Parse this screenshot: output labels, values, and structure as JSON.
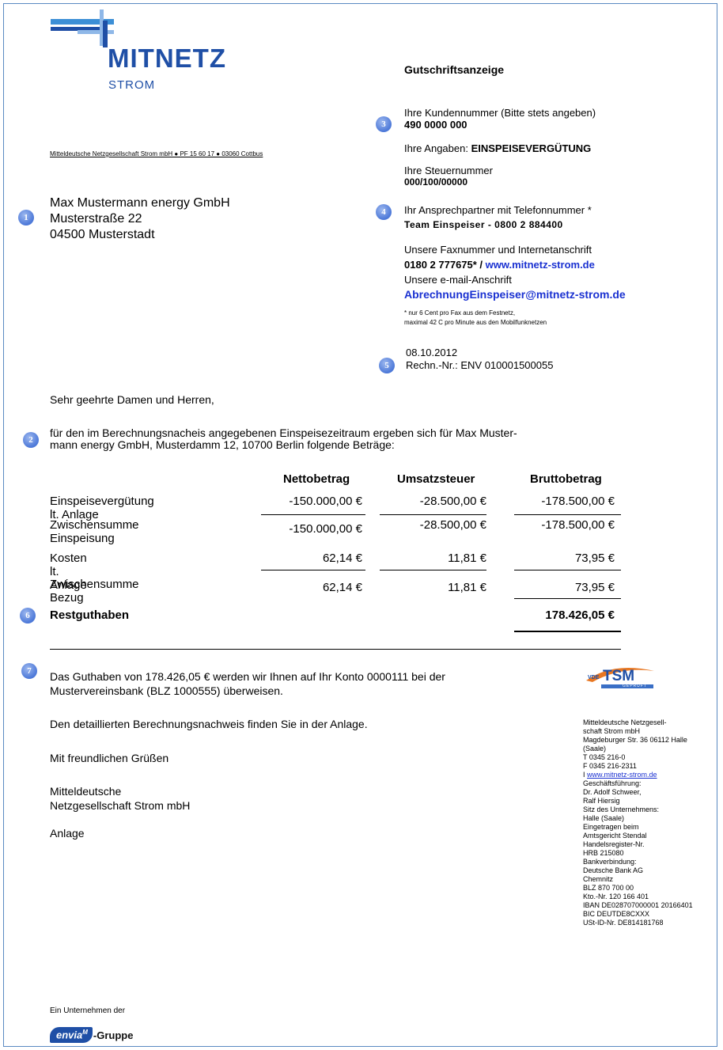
{
  "logo": {
    "name": "MITNETZ",
    "sub": "STROM"
  },
  "sender_line": "Mitteldeutsche Netzgesellschaft Strom mbH ● PF 15 60 17 ● 03060 Cottbus",
  "recipient": {
    "line1": "Max Mustermann energy GmbH",
    "line2": "Musterstraße 22",
    "line3": "04500 Musterstadt"
  },
  "info": {
    "title": "Gutschriftsanzeige",
    "customer_label": "Ihre Kundennummer (Bitte stets angeben)",
    "customer_number": "490 0000 000",
    "angaben_label": "Ihre Angaben: ",
    "angaben_value": "EINSPEISEVERGÜTUNG",
    "tax_label": "Ihre Steuernummer",
    "tax_number": "000/100/00000",
    "contact_label": "Ihr Ansprechpartner mit Telefonnummer *",
    "contact_value": "Team Einspeiser - 0800 2 884400",
    "fax_label": "Unsere Faxnummer und Internetanschrift",
    "fax_value": "0180 2 777675* / ",
    "web": "www.mitnetz-strom.de",
    "email_label": "Unsere e-mail-Anschrift",
    "email": "AbrechnungEinspeiser@mitnetz-strom.de",
    "note1": "*   nur 6 Cent pro Fax aus dem Festnetz,",
    "note2": "maximal 42 C pro Minute aus den Mobilfunknetzen",
    "date": "08.10.2012",
    "invoice": "Rechn.-Nr.: ENV 010001500055"
  },
  "badges": [
    "1",
    "2",
    "3",
    "4",
    "5",
    "6",
    "7"
  ],
  "greeting": "Sehr geehrte Damen und Herren,",
  "intro1": "für den im Berechnungsnacheis angegebenen Einspeisezeitraum ergeben sich für Max Muster-",
  "intro2": "mann energy GmbH, Musterdamm 12, 10700 Berlin folgende Beträge:",
  "table": {
    "headers": [
      "Nettobetrag",
      "Umsatzsteuer",
      "Bruttobetrag"
    ],
    "rows": [
      {
        "label": "Einspeisevergütung lt. Anlage",
        "values": [
          "-150.000,00 €",
          "-28.500,00 €",
          "-178.500,00 €"
        ]
      },
      {
        "label": "Zwischensumme Einspeisung",
        "values": [
          "-150.000,00 €",
          "-28.500,00 €",
          "-178.500,00 €"
        ]
      },
      {
        "label": "Kosten lt. Anlage",
        "values": [
          "62,14 €",
          "11,81 €",
          "73,95 €"
        ]
      },
      {
        "label": "Zwischensumme Bezug",
        "values": [
          "62,14 €",
          "11,81 €",
          "73,95 €"
        ]
      }
    ],
    "total_label": "Restguthaben",
    "total_value": "178.426,05 €"
  },
  "body": {
    "p1a": "Das Guthaben von 178.426,05 € werden wir Ihnen auf Ihr Konto 0000111 bei der",
    "p1b": "Mustervereinsbank (BLZ 1000555) überweisen.",
    "p2": "Den detaillierten Berechnungsnachweis finden Sie in der Anlage.",
    "closing": "Mit freundlichen Grüßen",
    "sig1": "Mitteldeutsche",
    "sig2": "Netzgesellschaft Strom mbH",
    "anlage": "Anlage"
  },
  "tsm": {
    "vde": "VDE",
    "tsm": "TSM",
    "geprueft": "GEPRÜFT"
  },
  "sidebar": {
    "name1": "Mitteldeutsche Netzgesell-",
    "name2": "schaft Strom mbH",
    "addr1": "Magdeburger Str. 36 06112 Halle",
    "addr2": "(Saale)",
    "tel": "T 0345 216-0",
    "fax": "F 0345 216-2311",
    "web_prefix": "I ",
    "web": "www.mitnetz-strom.de",
    "gf_label": "Geschäftsführung:",
    "gf1": "Dr.  Adolf  Schweer,",
    "gf2": "Ralf Hiersig",
    "sitz_label": "Sitz des Unternehmens:",
    "sitz1": "Halle (Saale)",
    "sitz2": "Eingetragen beim",
    "sitz3": "Amtsgericht Stendal",
    "sitz4": "Handelsregister-Nr.",
    "sitz5": "HRB 215080",
    "bank_label": "Bankverbindung:",
    "bank1": "Deutsche Bank AG",
    "bank2": "Chemnitz",
    "bank3": "BLZ 870 700 00",
    "bank4": "Kto.-Nr. 120 166 401",
    "bank5": "IBAN DE028707000001 20166401",
    "bank6": "BIC DEUTDE8CXXX",
    "ust": "USt-ID-Nr. DE814181768"
  },
  "footer": {
    "company_of": "Ein Unternehmen der",
    "group_logo": "envia",
    "group_sup": "M",
    "group_suffix": "-Gruppe"
  },
  "colors": {
    "brand_blue": "#1f4fa6",
    "link_blue": "#1a31d1",
    "badge_blue": "#4c78d8",
    "frame": "#5b8ac2"
  }
}
